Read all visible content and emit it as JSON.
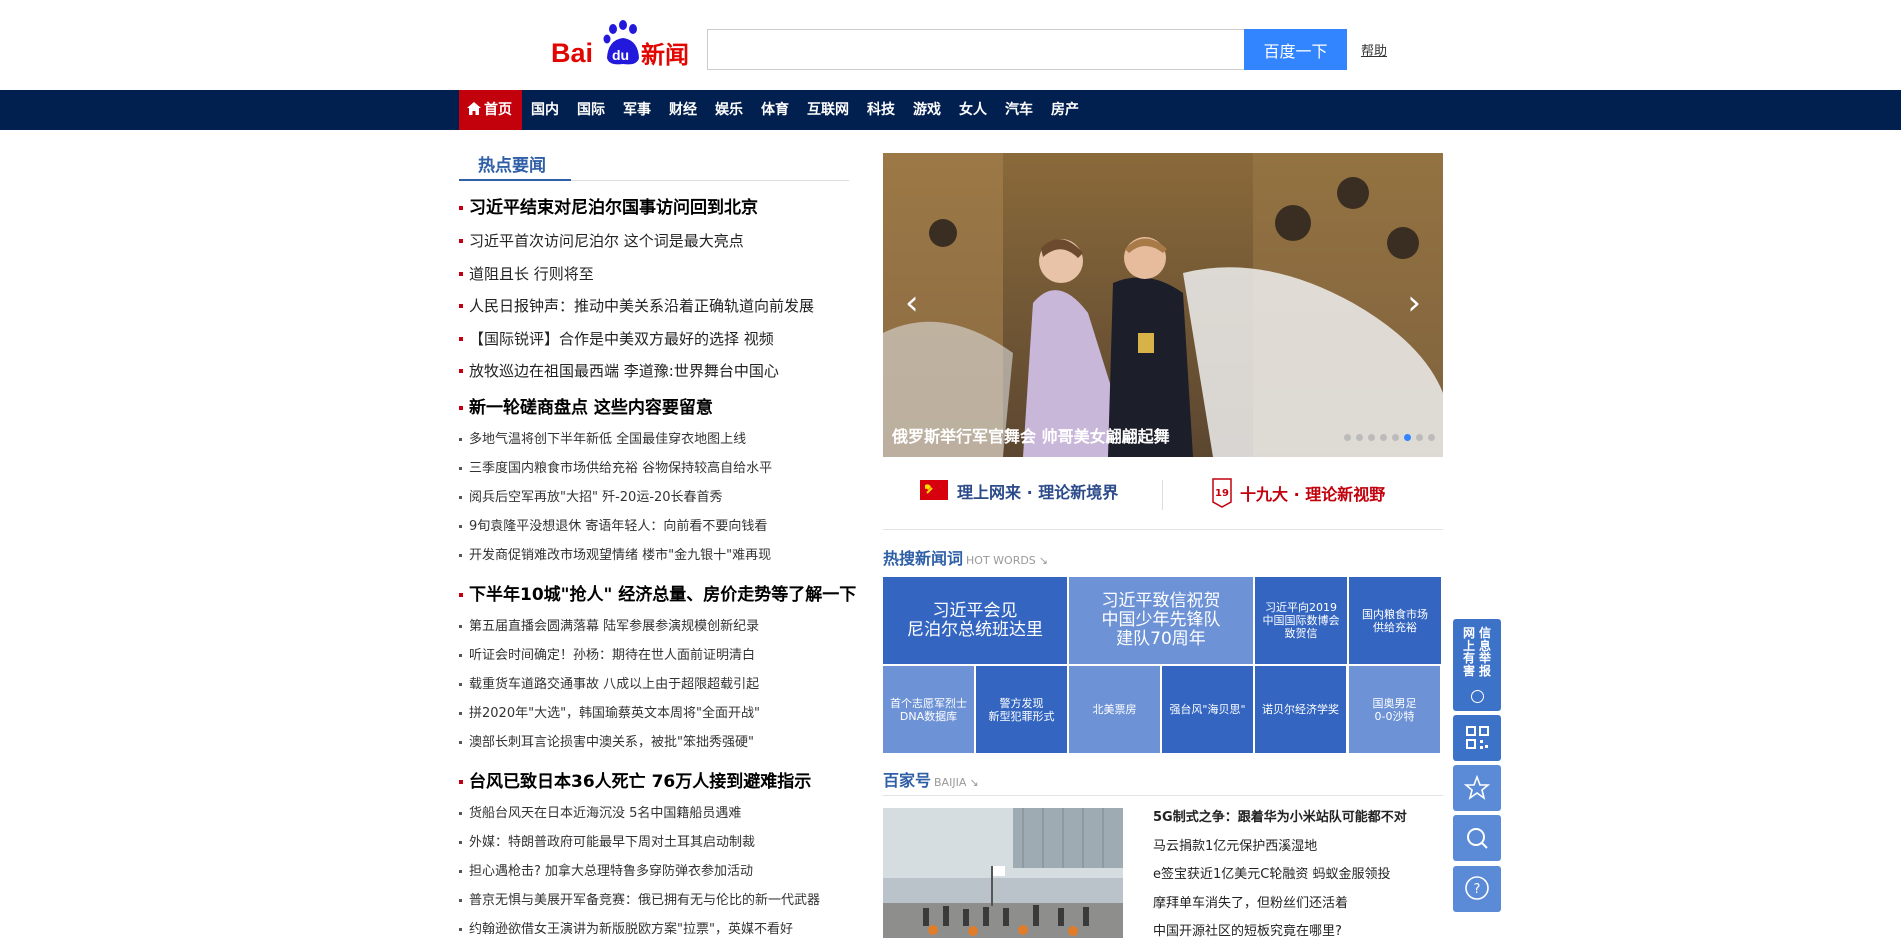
{
  "header": {
    "logo_text": "Bai du 新闻",
    "search_placeholder": "",
    "search_button": "百度一下",
    "help_link": "帮助"
  },
  "nav": {
    "items": [
      "首页",
      "国内",
      "国际",
      "军事",
      "财经",
      "娱乐",
      "体育",
      "互联网",
      "科技",
      "游戏",
      "女人",
      "汽车",
      "房产"
    ],
    "active_index": 0
  },
  "hot_news": {
    "tab_label": "热点要闻",
    "top_group": [
      {
        "text": "习近平结束对尼泊尔国事访问回到北京",
        "style": "big"
      },
      {
        "text": "习近平首次访问尼泊尔 这个词是最大亮点",
        "style": "mid"
      },
      {
        "text": "道阻且长 行则将至",
        "style": "mid"
      },
      {
        "text": "人民日报钟声：推动中美关系沿着正确轨道向前发展",
        "style": "mid"
      },
      {
        "text": "【国际锐评】合作是中美双方最好的选择 视频",
        "style": "mid"
      },
      {
        "text": "放牧巡边在祖国最西端 李道豫:世界舞台中国心",
        "style": "mid"
      }
    ],
    "group2": {
      "headline": "新一轮磋商盘点 这些内容要留意",
      "items": [
        "多地气温将创下半年新低 全国最佳穿衣地图上线",
        "三季度国内粮食市场供给充裕 谷物保持较高自给水平",
        "阅兵后空军再放\"大招\" 歼-20运-20长春首秀",
        "9旬袁隆平没想退休 寄语年轻人：向前看不要向钱看",
        "开发商促销难改市场观望情绪 楼市\"金九银十\"难再现"
      ]
    },
    "group3": {
      "headline": "下半年10城\"抢人\" 经济总量、房价走势等了解一下",
      "items": [
        "第五届直播会圆满落幕 陆军参展参演规模创新纪录",
        "听证会时间确定！孙杨：期待在世人面前证明清白",
        "载重货车道路交通事故 八成以上由于超限超载引起",
        "拼2020年\"大选\"，韩国瑜蔡英文本周将\"全面开战\"",
        "澳部长刺耳言论损害中澳关系，被批\"笨拙秀强硬\""
      ]
    },
    "group4": {
      "headline": "台风已致日本36人死亡 76万人接到避难指示",
      "items": [
        "货船台风天在日本近海沉没 5名中国籍船员遇难",
        "外媒：特朗普政府可能最早下周对土耳其启动制裁",
        "担心遇枪击? 加拿大总理特鲁多穿防弹衣参加活动",
        "普京无惧与美展开军备竞赛：俄已拥有无与伦比的新一代武器",
        "约翰逊欲借女王演讲为新版脱欧方案\"拉票\"，英媒不看好"
      ]
    }
  },
  "slider": {
    "caption": "俄罗斯举行军官舞会 帅哥美女翩翩起舞",
    "prev": "‹",
    "next": "›",
    "dot_count": 8,
    "active_dot": 5
  },
  "banners": {
    "left": "理上网来 · 理论新境界",
    "right": "十九大 · 理论新视野",
    "right_badge": "19"
  },
  "hot_words": {
    "title": "热搜新闻词",
    "subtitle": "HOT WORDS",
    "tiles": [
      "习近平会见\n尼泊尔总统班达里",
      "习近平致信祝贺\n中国少年先锋队\n建队70周年",
      "习近平向2019\n中国国际数博会\n致贺信",
      "国内粮食市场\n供给充裕",
      "首个志愿军烈士\nDNA数据库",
      "警方发现\n新型犯罪形式",
      "北美票房",
      "强台风\"海贝思\"",
      "诺贝尔经济学奖",
      "国奥男足\n0-0沙特"
    ],
    "tile_colors": {
      "dark": "#3466c1",
      "light": "#6d93d6"
    }
  },
  "baijia": {
    "title": "百家号",
    "subtitle": "BAIJIA",
    "items": [
      "5G制式之争：跟着华为小米站队可能都不对",
      "马云捐款1亿元保护西溪湿地",
      "e签宝获近1亿美元C轮融资 蚂蚁金服领投",
      "摩拜单车消失了，但粉丝们还活着",
      "中国开源社区的短板究竟在哪里?"
    ]
  },
  "side": {
    "report_text": "网上有害信息举报",
    "report_col1": "网\n上\n有\n害",
    "report_col2": "信\n息\n举\n报"
  },
  "colors": {
    "nav_bg": "#02204f",
    "nav_active": "#c3010d",
    "brand_blue": "#3385ff",
    "title_blue": "#2f5fa7",
    "red_bullet": "#c3010d"
  }
}
